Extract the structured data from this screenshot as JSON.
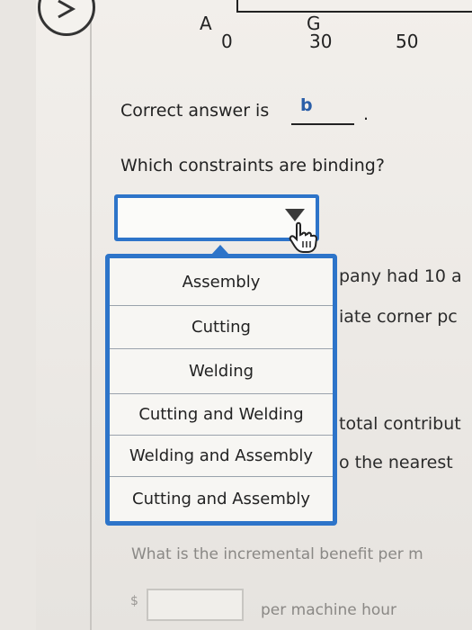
{
  "graph": {
    "point_a": "A",
    "point_g": "G",
    "ticks": [
      "0",
      "30",
      "50"
    ]
  },
  "answer": {
    "prefix": "Correct answer is",
    "value": "b",
    "suffix": "."
  },
  "question": "Which constraints are binding?",
  "dropdown": {
    "selected": "",
    "options": [
      "Assembly",
      "Cutting",
      "Welding",
      "Cutting and Welding",
      "Welding and Assembly",
      "Cutting and Assembly"
    ]
  },
  "background_text": [
    "pany had 10 a",
    "iate corner pc",
    "total contribut",
    "o the nearest"
  ],
  "incremental": {
    "question": "What is the incremental benefit per m",
    "currency": "$",
    "value": "",
    "unit": "per machine hour"
  },
  "colors": {
    "accent": "#2d74c9",
    "answer": "#2a5ea8"
  },
  "icons": [
    "chevron-right-icon",
    "dropdown-arrow-icon",
    "hand-cursor-icon"
  ]
}
